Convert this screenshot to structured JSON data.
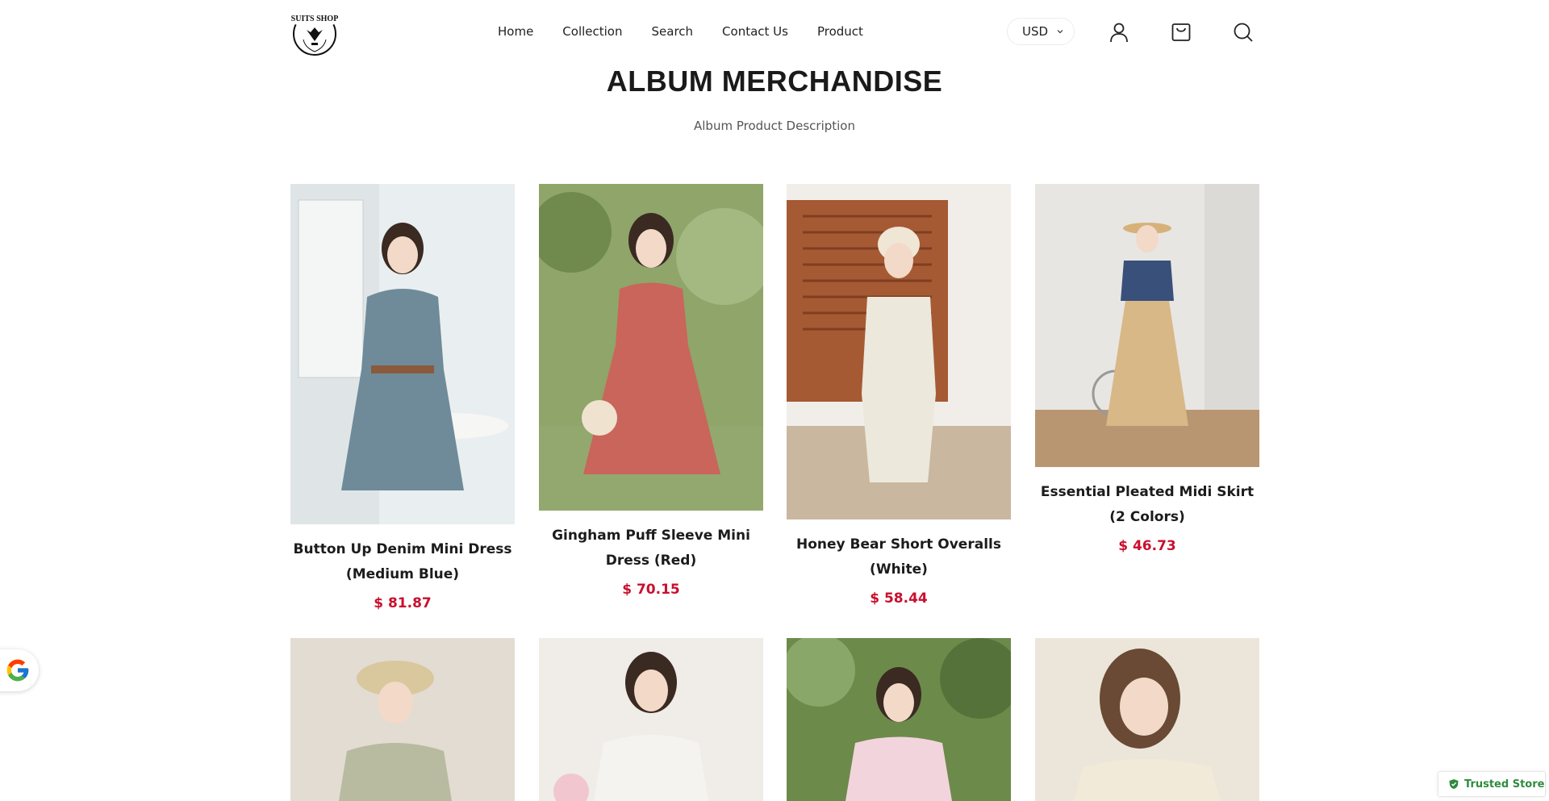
{
  "header": {
    "logo_text": "SUITS SHOP",
    "nav": [
      {
        "label": "Home"
      },
      {
        "label": "Collection"
      },
      {
        "label": "Search"
      },
      {
        "label": "Contact Us"
      },
      {
        "label": "Product"
      }
    ],
    "currency": "USD",
    "icons": [
      "user-icon",
      "shopping-bag-icon",
      "search-icon"
    ]
  },
  "page": {
    "title": "ALBUM MERCHANDISE",
    "description": "Album Product Description"
  },
  "products": [
    {
      "name": "Button Up Denim Mini Dress (Medium Blue)",
      "price": "$ 81.87",
      "image_colors": [
        "#e9eef0",
        "#6f8b99"
      ]
    },
    {
      "name": "Gingham Puff Sleeve Mini Dress (Red)",
      "price": "$ 70.15",
      "image_colors": [
        "#8fa56a",
        "#c9655b"
      ]
    },
    {
      "name": "Honey Bear Short Overalls (White)",
      "price": "$ 58.44",
      "image_colors": [
        "#a65a34",
        "#ece8dc"
      ]
    },
    {
      "name": "Essential Pleated Midi Skirt (2 Colors)",
      "price": "$ 46.73",
      "image_colors": [
        "#e8e6e2",
        "#d8b887"
      ]
    },
    {
      "name": "",
      "price": "",
      "image_colors": [
        "#e2dcd2",
        "#b9bba0"
      ]
    },
    {
      "name": "",
      "price": "",
      "image_colors": [
        "#f0ece8",
        "#f5f3f0"
      ]
    },
    {
      "name": "",
      "price": "",
      "image_colors": [
        "#6c8a4a",
        "#f2d4dc"
      ]
    },
    {
      "name": "",
      "price": "",
      "image_colors": [
        "#ece6da",
        "#f2ead8"
      ]
    }
  ],
  "badges": {
    "trusted_store": "Trusted Store",
    "google_icon": "google-g-icon"
  },
  "colors": {
    "price": "#c8102e",
    "trusted": "#2e8b3d"
  }
}
